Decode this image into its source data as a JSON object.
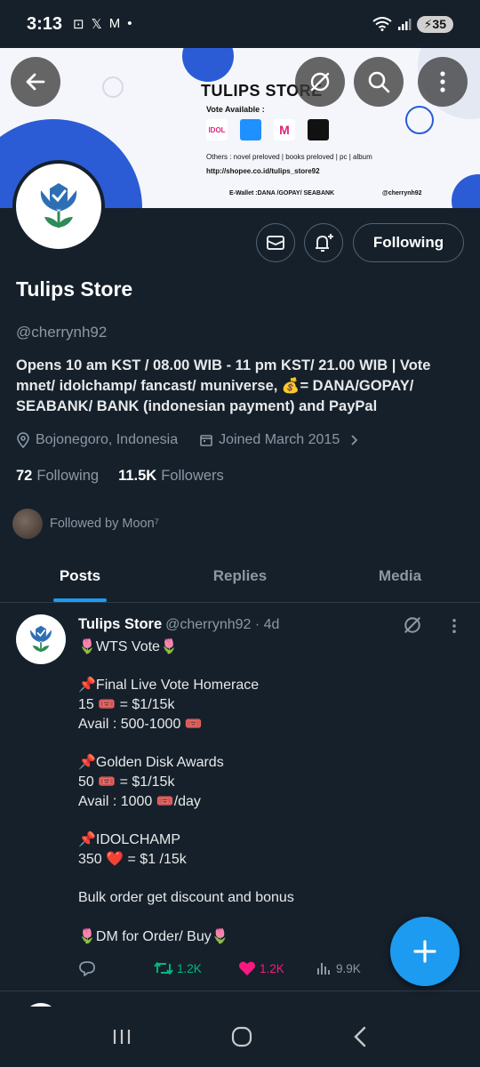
{
  "status_bar": {
    "time": "3:13",
    "battery": "35"
  },
  "banner": {
    "title": "TULIPS STORE",
    "vote_available": "Vote Available :",
    "logos": [
      "IDOL",
      "",
      "M",
      ""
    ],
    "others": "Others : novel preloved | books preloved | pc | album",
    "shop_url": "http://shopee.co.id/tulips_store92",
    "ewallet": "E-Wallet :DANA /GOPAY/ SEABANK",
    "handle": "@cherrynh92"
  },
  "profile": {
    "name": "Tulips Store",
    "handle": "@cherrynh92",
    "bio": "Opens 10 am KST / 08.00 WIB  - 11 pm KST/ 21.00 WIB |  Vote mnet/ idolchamp/ fancast/ muniverse, 💰= DANA/GOPAY/ SEABANK/ BANK (indonesian payment) and  PayPal",
    "location": "Bojonegoro, Indonesia",
    "joined": "Joined March 2015",
    "following_count": "72",
    "following_label": "Following",
    "followers_count": "11.5K",
    "followers_label": "Followers",
    "followed_by": "Followed by Moon⁷",
    "follow_button": "Following"
  },
  "tabs": [
    "Posts",
    "Replies",
    "Media"
  ],
  "post": {
    "author": "Tulips Store",
    "meta": "@cherrynh92 · 4d",
    "body": "🌷WTS Vote🌷\n\n📌Final Live Vote Homerace\n15 🎟️ = $1/15k\nAvail : 500-1000 🎟️\n\n📌Golden Disk Awards\n50 🎟️ = $1/15k\nAvail : 1000 🎟️/day\n\n📌IDOLCHAMP\n350 ❤️ = $1 /15k\n\nBulk order get discount and bonus\n\n🌷DM for Order/ Buy🌷",
    "reposts": "1.2K",
    "likes": "1.2K",
    "views": "9.9K"
  },
  "colors": {
    "accent": "#1d9bf0",
    "background": "#15202b",
    "like": "#f91880",
    "repost": "#00ba7c"
  }
}
